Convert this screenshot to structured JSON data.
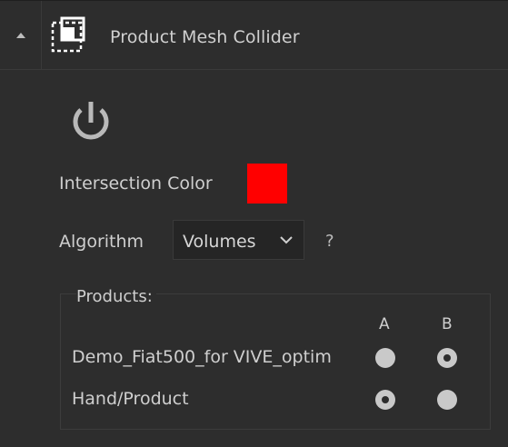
{
  "header": {
    "title": "Product Mesh Collider",
    "collapse_icon": "triangle-up-icon",
    "component_icon": "mesh-collider-icon"
  },
  "power": {
    "icon": "power-icon",
    "enabled": true
  },
  "intersection": {
    "label": "Intersection Color",
    "color": "#ff0000"
  },
  "algorithm": {
    "label": "Algorithm",
    "value": "Volumes",
    "help": "?"
  },
  "products": {
    "title": "Products:",
    "columns": [
      "A",
      "B"
    ],
    "rows": [
      {
        "label": "Demo_Fiat500_for VIVE_optim",
        "selected": "B"
      },
      {
        "label": "Hand/Product",
        "selected": "A"
      }
    ]
  }
}
